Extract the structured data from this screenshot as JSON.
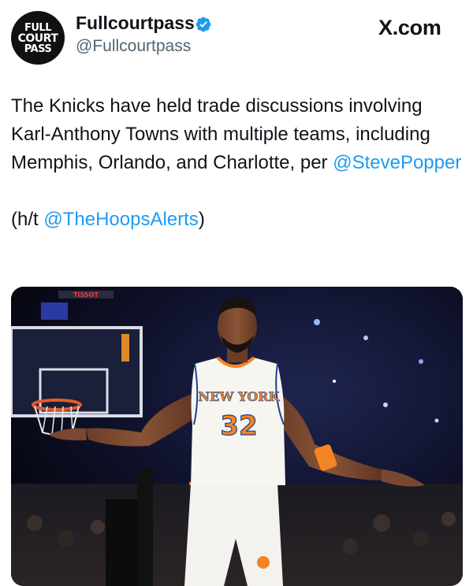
{
  "account": {
    "avatar_lines": [
      "FULL",
      "COURT",
      "PASS"
    ],
    "display_name": "Fullcourtpass",
    "handle": "@Fullcourtpass",
    "verified": true
  },
  "source_mark": "X.com",
  "tweet": {
    "line1_text": "The Knicks have held trade discussions involving Karl-Anthony Towns with multiple teams, including Memphis, Orlando, and Charlotte, per",
    "line1_mention": "@StevePopper",
    "line2_prefix": "(h/t",
    "line2_mention": "@TheHoopsAlerts",
    "line2_suffix": ")"
  },
  "photo": {
    "jersey_team": "NEW YORK",
    "jersey_number": "32",
    "backboard_ad": "TISSOT"
  },
  "colors": {
    "mention": "#1d9bf0",
    "verified_badge": "#1d9bf0",
    "text": "#0f1419",
    "secondary_text": "#536471",
    "knicks_orange": "#f58426"
  }
}
